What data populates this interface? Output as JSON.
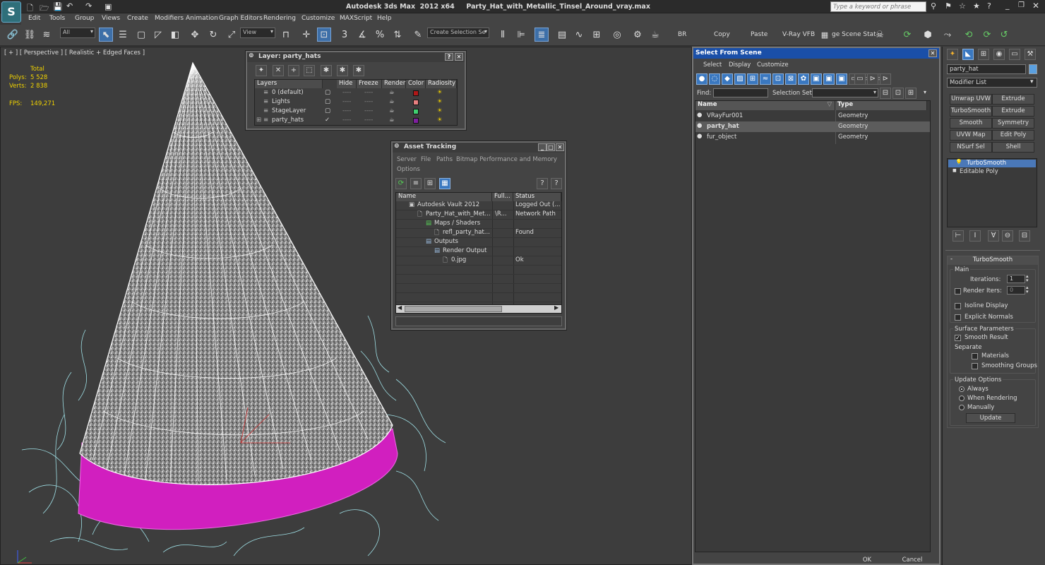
{
  "app": {
    "title": "Autodesk 3ds Max  2012 x64     Party_Hat_with_Metallic_Tinsel_Around_vray.max",
    "search_placeholder": "Type a keyword or phrase"
  },
  "menu": [
    "Edit",
    "Tools",
    "Group",
    "Views",
    "Create",
    "Modifiers",
    "Animation",
    "Graph Editors",
    "Rendering",
    "Customize",
    "MAXScript",
    "Help"
  ],
  "toolbar": {
    "filter": "All",
    "ref_coord": "View",
    "selection_set": "Create Selection Se",
    "br": "BR",
    "copy": "Copy",
    "paste": "Paste",
    "vray_vfb": "V-Ray VFB",
    "scene_states": "ge Scene Stat"
  },
  "viewport": {
    "label": "[ + ] [ Perspective ] [ Realistic + Edged Faces ]",
    "stats": {
      "total_label": "Total",
      "polys_label": "Polys:",
      "polys": "5 528",
      "verts_label": "Verts:",
      "verts": "2 838",
      "fps_label": "FPS:",
      "fps": "149,271"
    }
  },
  "layer_window": {
    "title": "Layer: party_hats",
    "columns": [
      "Layers",
      "Hide",
      "Freeze",
      "Render",
      "Color",
      "Radiosity"
    ],
    "rows": [
      {
        "name": "0 (default)",
        "color": "#b01818",
        "current": false
      },
      {
        "name": "Lights",
        "color": "#e88080",
        "current": false
      },
      {
        "name": "StageLayer",
        "color": "#40d070",
        "current": false
      },
      {
        "name": "party_hats",
        "color": "#8020a0",
        "current": true
      }
    ]
  },
  "asset_window": {
    "title": "Asset Tracking",
    "menu": [
      "Server",
      "File",
      "Paths",
      "Bitmap Performance and Memory"
    ],
    "menu2": "Options",
    "columns": [
      "Name",
      "Full...",
      "Status"
    ],
    "rows": [
      {
        "name": "Autodesk Vault 2012",
        "full": "",
        "status": "Logged Out (...",
        "indent": 1
      },
      {
        "name": "Party_Hat_with_Met...",
        "full": "\\R...",
        "status": "Network Path",
        "indent": 2
      },
      {
        "name": "Maps / Shaders",
        "full": "",
        "status": "",
        "indent": 3
      },
      {
        "name": "refl_party_hat...",
        "full": "",
        "status": "Found",
        "indent": 4
      },
      {
        "name": "Outputs",
        "full": "",
        "status": "",
        "indent": 3
      },
      {
        "name": "Render Output",
        "full": "",
        "status": "",
        "indent": 4
      },
      {
        "name": "0.jpg",
        "full": "",
        "status": "Ok",
        "indent": 5
      }
    ]
  },
  "select_window": {
    "title": "Select From Scene",
    "menu": [
      "Select",
      "Display",
      "Customize"
    ],
    "find_label": "Find:",
    "selset_label": "Selection Set:",
    "columns": [
      "Name",
      "Type"
    ],
    "rows": [
      {
        "name": "VRayFur001",
        "type": "Geometry",
        "selected": false
      },
      {
        "name": "party_hat",
        "type": "Geometry",
        "selected": true
      },
      {
        "name": "fur_object",
        "type": "Geometry",
        "selected": false
      }
    ],
    "ok": "OK",
    "cancel": "Cancel"
  },
  "command_panel": {
    "object_name": "party_hat",
    "modifier_list": "Modifier List",
    "buttons": [
      "Unwrap UVW",
      "Extrude",
      "TurboSmooth",
      "Extrude",
      "Smooth",
      "Symmetry",
      "UVW Map",
      "Edit Poly",
      "NSurf Sel",
      "Shell"
    ],
    "stack": [
      "TurboSmooth",
      "Editable Poly"
    ],
    "rollout_title": "TurboSmooth",
    "main": "Main",
    "iterations_label": "Iterations:",
    "iterations": "1",
    "render_iters_label": "Render Iters:",
    "render_iters": "0",
    "isoline": "Isoline Display",
    "explicit_normals": "Explicit Normals",
    "surface_params": "Surface Parameters",
    "smooth_result": "Smooth Result",
    "separate": "Separate",
    "materials": "Materials",
    "smoothing_groups": "Smoothing Groups",
    "update_options": "Update Options",
    "always": "Always",
    "when_rendering": "When Rendering",
    "manually": "Manually",
    "update": "Update"
  }
}
